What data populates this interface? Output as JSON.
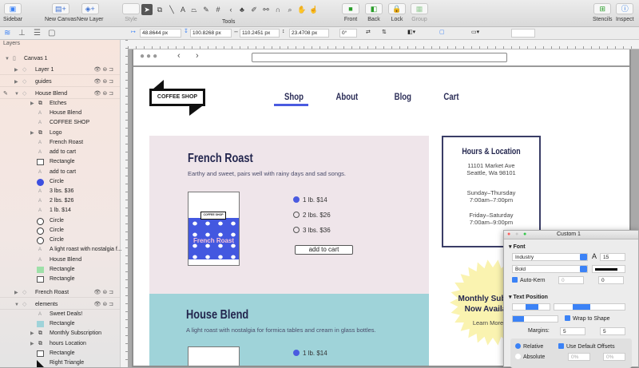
{
  "toolbar": {
    "sidebar": "Sidebar",
    "new_canvas": "New Canvas",
    "new_layer": "New Layer",
    "style": "Style",
    "tools": "Tools",
    "front": "Front",
    "back": "Back",
    "lock": "Lock",
    "group": "Group",
    "stencils": "Stencils",
    "inspect": "Inspect"
  },
  "format_bar": {
    "x": "48.8644 px",
    "y": "100.8268 px",
    "width": "110.2451 px",
    "height": "23.4708 px",
    "rotation": "0°"
  },
  "sidebar": {
    "title": "Layers",
    "rows": [
      {
        "label": "Canvas 1",
        "kind": "canvas"
      },
      {
        "label": "Layer 1",
        "kind": "layer"
      },
      {
        "label": "guides",
        "kind": "layer"
      },
      {
        "label": "House Blend",
        "kind": "layer"
      },
      {
        "label": "Etches",
        "kind": "group"
      },
      {
        "label": "House Blend",
        "kind": "text"
      },
      {
        "label": "COFFEE SHOP",
        "kind": "text"
      },
      {
        "label": "Logo",
        "kind": "group"
      },
      {
        "label": "French Roast",
        "kind": "text"
      },
      {
        "label": "add to cart",
        "kind": "text"
      },
      {
        "label": "Rectangle",
        "kind": "rect"
      },
      {
        "label": "add to cart",
        "kind": "text"
      },
      {
        "label": "Circle",
        "kind": "circle-filled"
      },
      {
        "label": "3 lbs. $36",
        "kind": "text"
      },
      {
        "label": "2 lbs. $26",
        "kind": "text"
      },
      {
        "label": "1 lb. $14",
        "kind": "text"
      },
      {
        "label": "Circle",
        "kind": "circle"
      },
      {
        "label": "Circle",
        "kind": "circle"
      },
      {
        "label": "Circle",
        "kind": "circle"
      },
      {
        "label": "A light roast with nostalgia f...",
        "kind": "text"
      },
      {
        "label": "House Blend",
        "kind": "text"
      },
      {
        "label": "Rectangle",
        "kind": "rect-green"
      },
      {
        "label": "Rectangle",
        "kind": "rect"
      },
      {
        "label": "French Roast",
        "kind": "layer"
      },
      {
        "label": "elements",
        "kind": "layer"
      },
      {
        "label": "Sweet Deals!",
        "kind": "text"
      },
      {
        "label": "Rectangle",
        "kind": "rect-teal"
      },
      {
        "label": "Monthly Subscription",
        "kind": "group"
      },
      {
        "label": "hours Location",
        "kind": "group"
      },
      {
        "label": "Rectangle",
        "kind": "rect"
      },
      {
        "label": "Right Triangle",
        "kind": "triangle"
      }
    ]
  },
  "page": {
    "nav": [
      "Shop",
      "About",
      "Blog",
      "Cart"
    ],
    "logo_text": "COFFEE SHOP",
    "french": {
      "title": "French Roast",
      "desc": "Earthy and sweet, pairs well with rainy days and sad songs.",
      "bag_label": "French Roast",
      "options": [
        "1 lb. $14",
        "2 lbs. $26",
        "3 lbs. $36"
      ],
      "selected": 0,
      "button": "add to cart"
    },
    "house": {
      "title": "House Blend",
      "desc": "A light roast with nostalgia for formica tables and cream in glass bottles.",
      "options": [
        "1 lb. $14"
      ],
      "selected": 0
    },
    "hours": {
      "title": "Hours & Location",
      "address1": "11101 Market Ave",
      "address2": "Seattle, Wa 98101",
      "days1": "Sunday–Thursday",
      "time1": "7:00am–7:00pm",
      "days2": "Friday–Saturday",
      "time2": "7:00am–9:00pm"
    },
    "promo": {
      "line1": "Monthly Subscr",
      "line2": "Now Availab",
      "link": "Learn More"
    }
  },
  "inspector": {
    "title": "Custom 1",
    "font_section": "Font",
    "font_family": "Industry",
    "font_size": "15",
    "font_weight": "Bold",
    "auto_kern": "Auto-Kern",
    "kern_value": "0",
    "baseline": "0",
    "text_position": "Text Position",
    "wrap": "Wrap to Shape",
    "margins_label": "Margins:",
    "margin_left": "5",
    "margin_right": "5",
    "relative": "Relative",
    "absolute": "Absolute",
    "use_default": "Use Default Offsets",
    "offset1": "0%",
    "offset2": "0%"
  },
  "colors": {
    "accent": "#4a5be0",
    "pink": "#efe5ea",
    "teal": "#9fd3d9",
    "navy": "#23264e",
    "star": "#faf3b0"
  }
}
